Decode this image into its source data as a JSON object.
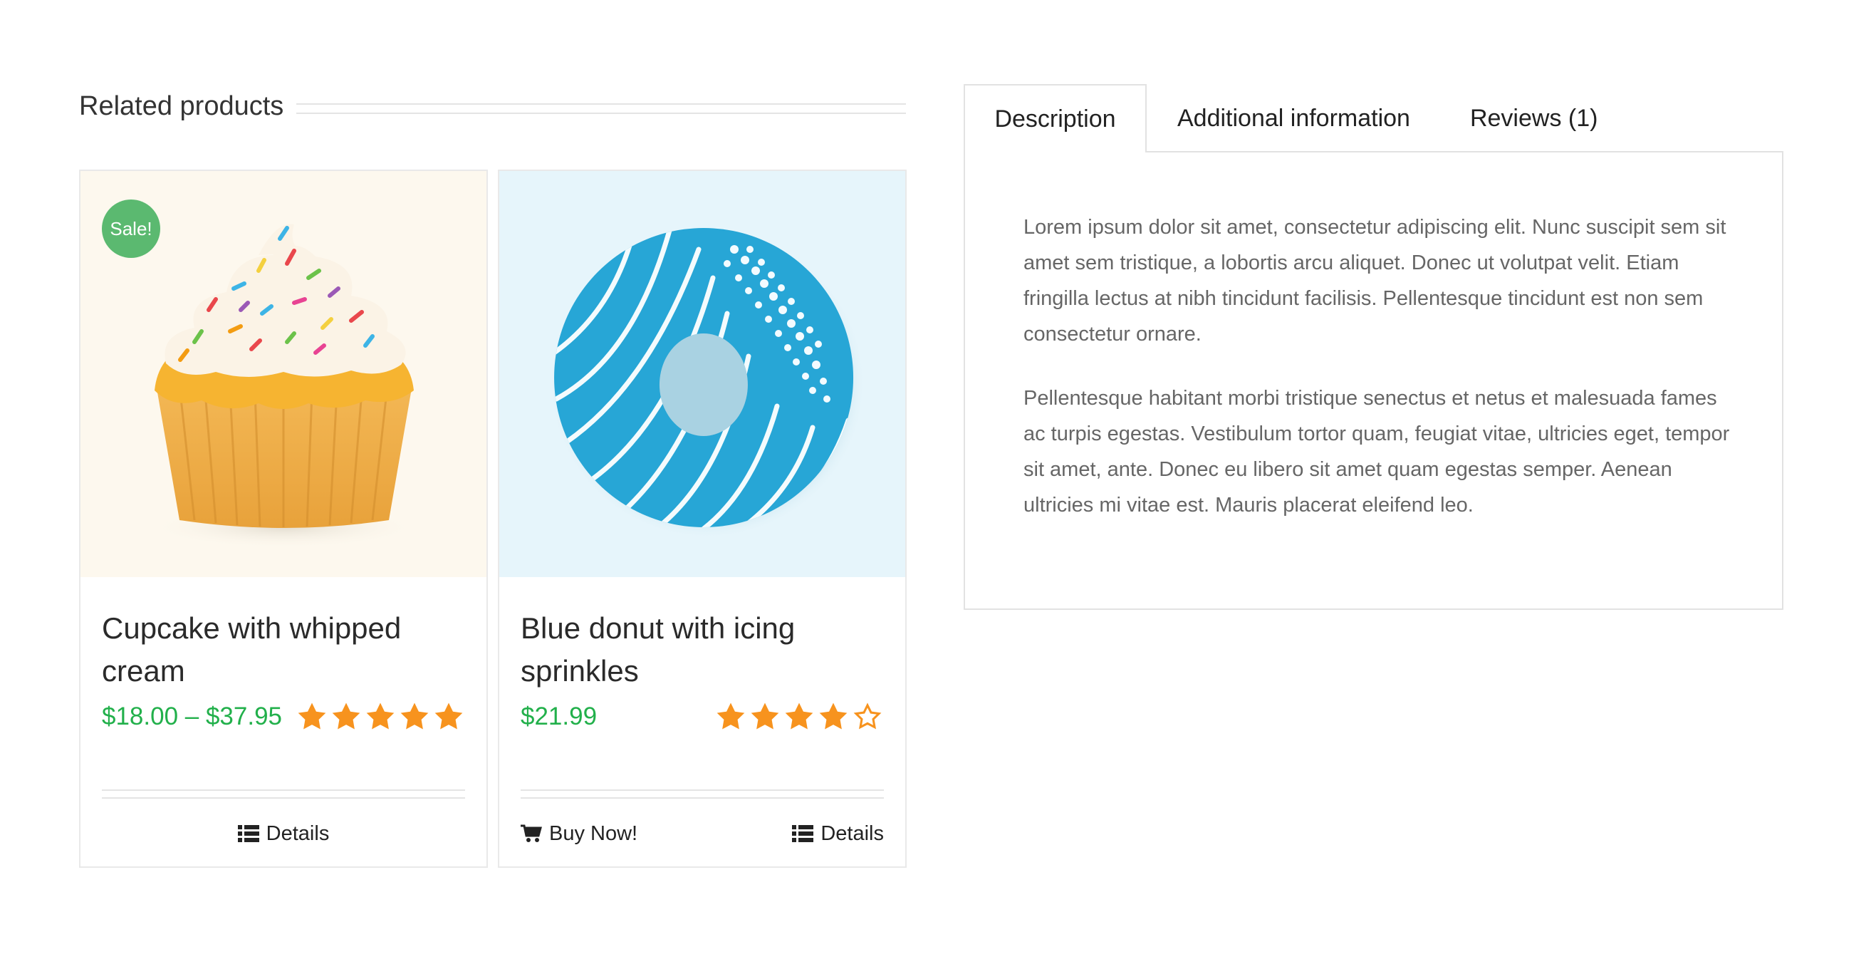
{
  "related": {
    "title": "Related products",
    "products": [
      {
        "badge": "Sale!",
        "title": "Cupcake with whipped cream",
        "price": "$18.00 – $37.95",
        "rating": 5,
        "rating_max": 5,
        "actions": {
          "details": "Details"
        }
      },
      {
        "title": "Blue donut with icing sprinkles",
        "price": "$21.99",
        "rating": 4,
        "rating_max": 5,
        "actions": {
          "buy": "Buy Now!",
          "details": "Details"
        }
      }
    ]
  },
  "tabs": {
    "items": [
      "Description",
      "Additional information",
      "Reviews (1)"
    ],
    "active": "Description",
    "description": {
      "paragraphs": [
        "Lorem ipsum dolor sit amet, consectetur adipiscing elit. Nunc suscipit sem sit amet sem tristique, a lobortis arcu aliquet. Donec ut volutpat velit. Etiam fringilla lectus at nibh tincidunt facilisis. Pellentesque tincidunt est non sem consectetur ornare.",
        "Pellentesque habitant morbi tristique senectus et netus et malesuada fames ac turpis egestas. Vestibulum tortor quam, feugiat vitae, ultricies eget, tempor sit amet, ante. Donec eu libero sit amet quam egestas semper. Aenean ultricies mi vitae est. Mauris placerat eleifend leo."
      ]
    }
  },
  "colors": {
    "price": "#22b04b",
    "star": "#f7931e",
    "sale_badge": "#5bb970",
    "border": "#e2e2e2"
  },
  "icons": [
    "list-icon",
    "cart-icon",
    "star-icon",
    "star-outline-icon"
  ]
}
